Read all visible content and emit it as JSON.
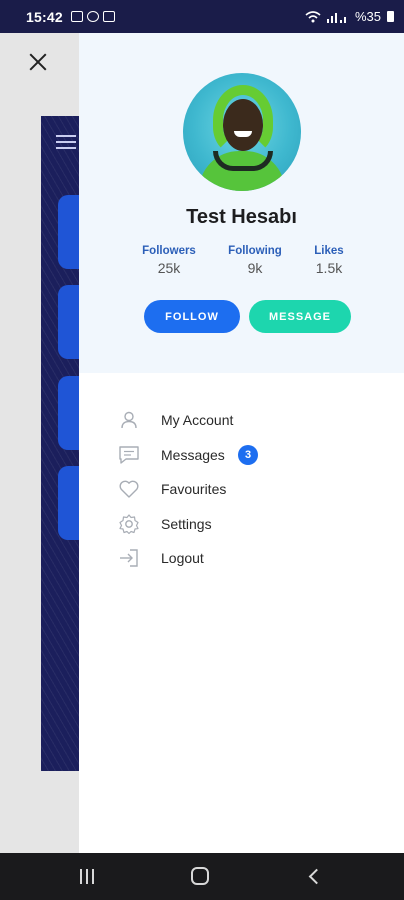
{
  "status_bar": {
    "time": "15:42",
    "battery": "%35"
  },
  "profile": {
    "name": "Test Hesabı",
    "stats": [
      {
        "label": "Followers",
        "value": "25k"
      },
      {
        "label": "Following",
        "value": "9k"
      },
      {
        "label": "Likes",
        "value": "1.5k"
      }
    ],
    "follow_label": "FOLLOW",
    "message_label": "MESSAGE"
  },
  "menu": {
    "items": [
      {
        "label": "My Account",
        "icon": "user-icon"
      },
      {
        "label": "Messages",
        "icon": "message-icon",
        "badge": "3"
      },
      {
        "label": "Favourites",
        "icon": "heart-icon"
      },
      {
        "label": "Settings",
        "icon": "gear-icon"
      },
      {
        "label": "Logout",
        "icon": "logout-icon"
      }
    ]
  },
  "colors": {
    "accent_blue": "#1d6ef0",
    "accent_teal": "#1dd6ae",
    "status_bar": "#1a1c49",
    "profile_bg": "#f1f7fd"
  }
}
